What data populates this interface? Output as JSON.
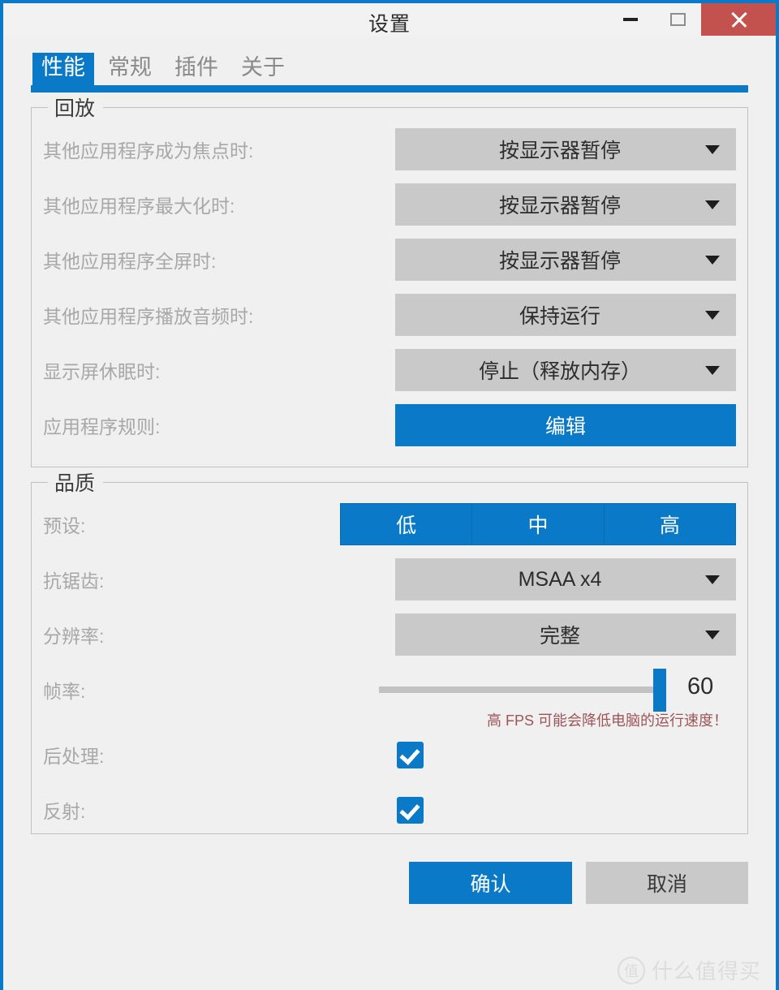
{
  "window": {
    "title": "设置",
    "accent_color": "#0a7ac8",
    "close_color": "#c3514d",
    "controls": {
      "minimize": "minimize-icon",
      "maximize": "maximize-icon",
      "close": "close-icon"
    }
  },
  "tabs": [
    {
      "label": "性能",
      "active": true
    },
    {
      "label": "常规",
      "active": false
    },
    {
      "label": "插件",
      "active": false
    },
    {
      "label": "关于",
      "active": false
    }
  ],
  "playback": {
    "legend": "回放",
    "rows": [
      {
        "label": "其他应用程序成为焦点时:",
        "value": "按显示器暂停",
        "type": "dropdown"
      },
      {
        "label": "其他应用程序最大化时:",
        "value": "按显示器暂停",
        "type": "dropdown"
      },
      {
        "label": "其他应用程序全屏时:",
        "value": "按显示器暂停",
        "type": "dropdown"
      },
      {
        "label": "其他应用程序播放音频时:",
        "value": "保持运行",
        "type": "dropdown"
      },
      {
        "label": "显示屏休眠时:",
        "value": "停止（释放内存）",
        "type": "dropdown"
      },
      {
        "label": "应用程序规则:",
        "value": "编辑",
        "type": "button"
      }
    ]
  },
  "quality": {
    "legend": "品质",
    "preset": {
      "label": "预设:",
      "options": [
        "低",
        "中",
        "高"
      ]
    },
    "antialias": {
      "label": "抗锯齿:",
      "value": "MSAA x4"
    },
    "resolution": {
      "label": "分辨率:",
      "value": "完整"
    },
    "framerate": {
      "label": "帧率:",
      "value": "60",
      "min": "0",
      "max": "60",
      "warning": "高 FPS 可能会降低电脑的运行速度！",
      "warning_color": "#9e5556"
    },
    "postprocessing": {
      "label": "后处理:",
      "checked": true
    },
    "reflection": {
      "label": "反射:",
      "checked": true
    }
  },
  "footer": {
    "confirm": "确认",
    "cancel": "取消"
  },
  "watermark": {
    "badge": "值",
    "text": "什么值得买"
  }
}
